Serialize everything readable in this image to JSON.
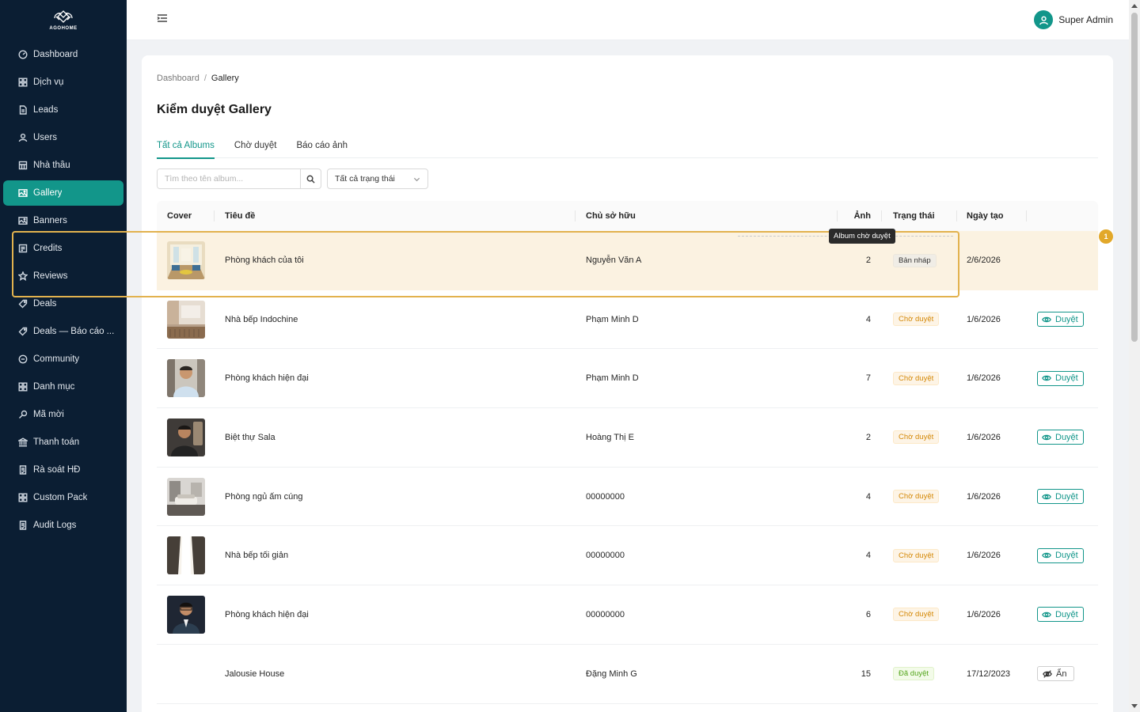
{
  "brand": {
    "name": "AGOHOME"
  },
  "sidebar": {
    "items": [
      {
        "label": "Dashboard",
        "icon": "dashboard-icon"
      },
      {
        "label": "Dịch vụ",
        "icon": "grid-icon"
      },
      {
        "label": "Leads",
        "icon": "file-icon"
      },
      {
        "label": "Users",
        "icon": "user-icon"
      },
      {
        "label": "Nhà thầu",
        "icon": "building-icon"
      },
      {
        "label": "Gallery",
        "icon": "image-icon",
        "active": true
      },
      {
        "label": "Banners",
        "icon": "image-icon"
      },
      {
        "label": "Credits",
        "icon": "credit-icon"
      },
      {
        "label": "Reviews",
        "icon": "star-icon"
      },
      {
        "label": "Deals",
        "icon": "tag-icon"
      },
      {
        "label": "Deals — Báo cáo ...",
        "icon": "tag-icon"
      },
      {
        "label": "Community",
        "icon": "chat-icon"
      },
      {
        "label": "Danh mục",
        "icon": "grid-icon"
      },
      {
        "label": "Mã mời",
        "icon": "key-icon"
      },
      {
        "label": "Thanh toán",
        "icon": "bank-icon"
      },
      {
        "label": "Rà soát HĐ",
        "icon": "audit-icon"
      },
      {
        "label": "Custom Pack",
        "icon": "grid-icon"
      },
      {
        "label": "Audit Logs",
        "icon": "audit-icon"
      }
    ]
  },
  "header": {
    "user_name": "Super Admin"
  },
  "breadcrumb": {
    "root": "Dashboard",
    "separator": "/",
    "current": "Gallery"
  },
  "page": {
    "title": "Kiểm duyệt Gallery"
  },
  "tabs": [
    {
      "label": "Tất cả Albums",
      "active": true
    },
    {
      "label": "Chờ duyệt"
    },
    {
      "label": "Báo cáo ảnh"
    }
  ],
  "filters": {
    "search_placeholder": "Tìm theo tên album...",
    "status_select": "Tất cả trạng thái"
  },
  "table": {
    "columns": [
      "Cover",
      "Tiêu đề",
      "Chủ sở hữu",
      "Ảnh",
      "Trạng thái",
      "Ngày tạo"
    ],
    "rows": [
      {
        "title": "Phòng khách của tôi",
        "owner": "Nguyễn Văn A",
        "count": "2",
        "status": "Bản nháp",
        "status_type": "draft",
        "date": "2/6/2026",
        "action": "",
        "thumb": "living-room"
      },
      {
        "title": "Nhà bếp Indochine",
        "owner": "Phạm Minh D",
        "count": "4",
        "status": "Chờ duyệt",
        "status_type": "pending",
        "date": "1/6/2026",
        "action": "Duyệt",
        "thumb": "kitchen"
      },
      {
        "title": "Phòng khách hiện đại",
        "owner": "Phạm Minh D",
        "count": "7",
        "status": "Chờ duyệt",
        "status_type": "pending",
        "date": "1/6/2026",
        "action": "Duyệt",
        "thumb": "portrait-light"
      },
      {
        "title": "Biệt thự Sala",
        "owner": "Hoàng Thị E",
        "count": "2",
        "status": "Chờ duyệt",
        "status_type": "pending",
        "date": "1/6/2026",
        "action": "Duyệt",
        "thumb": "portrait-dark"
      },
      {
        "title": "Phòng ngủ ấm cúng",
        "owner": "00000000",
        "count": "4",
        "status": "Chờ duyệt",
        "status_type": "pending",
        "date": "1/6/2026",
        "action": "Duyệt",
        "thumb": "bedroom"
      },
      {
        "title": "Nhà bếp tối giản",
        "owner": "00000000",
        "count": "4",
        "status": "Chờ duyệt",
        "status_type": "pending",
        "date": "1/6/2026",
        "action": "Duyệt",
        "thumb": "light-beam"
      },
      {
        "title": "Phòng khách hiện đại",
        "owner": "00000000",
        "count": "6",
        "status": "Chờ duyệt",
        "status_type": "pending",
        "date": "1/6/2026",
        "action": "Duyệt",
        "thumb": "portrait-suit"
      },
      {
        "title": "Jalousie House",
        "owner": "Đặng Minh G",
        "count": "15",
        "status": "Đã duyệt",
        "status_type": "approved",
        "date": "17/12/2023",
        "action": "Ẩn",
        "thumb": ""
      }
    ]
  },
  "tour": {
    "tooltip": "Album chờ duyệt",
    "step": "1"
  },
  "colors": {
    "primary": "#12968a",
    "sidebar": "#0b1e33",
    "highlight": "#e2b24e",
    "pending": "#d48806",
    "approved": "#52a41a"
  }
}
